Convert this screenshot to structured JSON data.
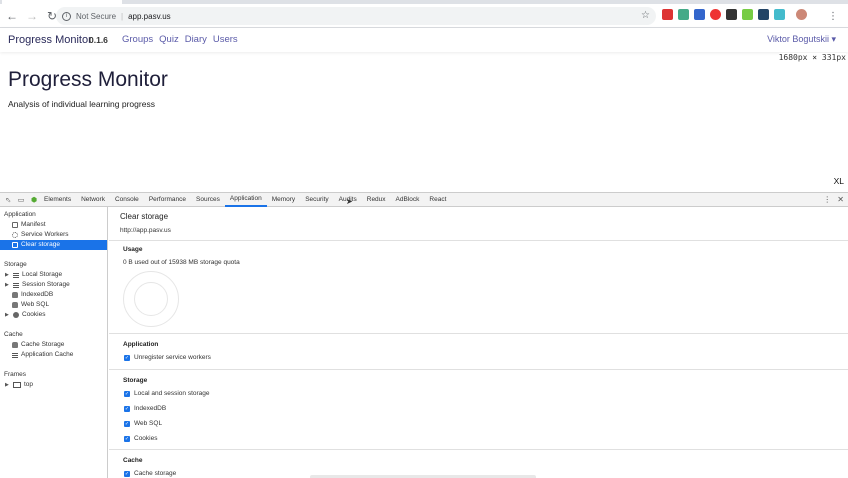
{
  "browser": {
    "security_label": "Not Secure",
    "url": "app.pasv.us"
  },
  "app": {
    "brand": "Progress Monitor",
    "version": "0.1.6",
    "nav": [
      "Groups",
      "Quiz",
      "Diary",
      "Users"
    ],
    "user": "Viktor Bogutskii",
    "viewport_tooltip": "1680px × 331px",
    "hero_title": "Progress Monitor",
    "hero_subtitle": "Analysis of individual learning progress",
    "breakpoint": "XL"
  },
  "devtools": {
    "tabs": [
      "Elements",
      "Network",
      "Console",
      "Performance",
      "Sources",
      "Application",
      "Memory",
      "Security",
      "Audits",
      "Redux",
      "AdBlock",
      "React"
    ],
    "active_tab": "Application",
    "sidebar": {
      "application_heading": "Application",
      "application_items": [
        "Manifest",
        "Service Workers",
        "Clear storage"
      ],
      "storage_heading": "Storage",
      "storage_items": [
        "Local Storage",
        "Session Storage",
        "IndexedDB",
        "Web SQL",
        "Cookies"
      ],
      "cache_heading": "Cache",
      "cache_items": [
        "Cache Storage",
        "Application Cache"
      ],
      "frames_heading": "Frames",
      "frames_items": [
        "top"
      ]
    },
    "panel": {
      "title": "Clear storage",
      "origin": "http://app.pasv.us",
      "usage_heading": "Usage",
      "quota_text": "0 B used out of 15938 MB storage quota",
      "application_heading": "Application",
      "application_options": [
        "Unregister service workers"
      ],
      "storage_heading": "Storage",
      "storage_options": [
        "Local and session storage",
        "IndexedDB",
        "Web SQL",
        "Cookies"
      ],
      "cache_heading": "Cache",
      "cache_options": [
        "Cache storage"
      ]
    }
  }
}
